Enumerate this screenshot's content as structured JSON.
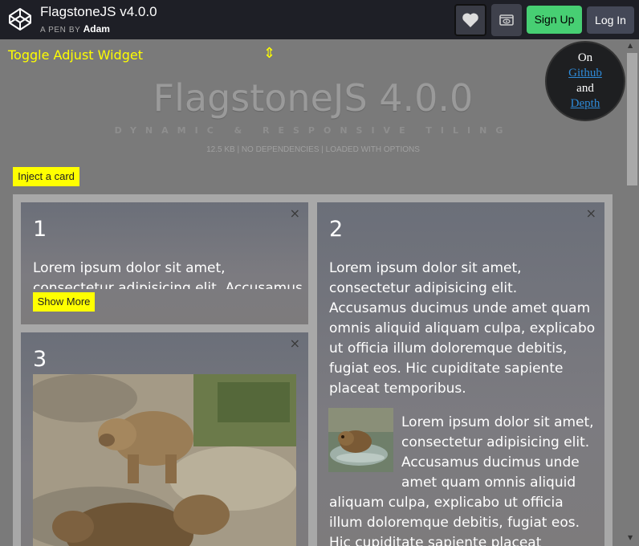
{
  "header": {
    "title": "FlagstoneJS v4.0.0",
    "by_label": "A PEN BY",
    "author": "Adam",
    "signup_label": "Sign Up",
    "login_label": "Log In"
  },
  "preview": {
    "toggle_label": "Toggle Adjust Widget",
    "toggle_icon": "⇕",
    "badge": {
      "line1": "On",
      "link1": "Github",
      "line2": "and",
      "link2": "Depth"
    },
    "title": "FlagstoneJS 4.0.0",
    "subtitle": "DYNAMIC & RESPONSIVE TILING",
    "meta": "12.5 KB | NO DEPENDENCIES | LOADED WITH OPTIONS",
    "inject_label": "Inject a card",
    "cards": [
      {
        "number": "1",
        "text": "Lorem ipsum dolor sit amet, consectetur adipisicing elit. Accusamus",
        "show_more": "Show More"
      },
      {
        "number": "2",
        "text": "Lorem ipsum dolor sit amet, consectetur adipisicing elit. Accusamus ducimus unde amet quam omnis aliquid aliquam culpa, explicabo ut officia illum doloremque debitis, fugiat eos. Hic cupiditate sapiente placeat temporibus.",
        "text2": "Lorem ipsum dolor sit amet, consectetur adipisicing elit. Accusamus ducimus unde amet quam omnis aliquid aliquam culpa, explicabo ut officia illum doloremque debitis, fugiat eos. Hic cupiditate sapiente placeat"
      },
      {
        "number": "3"
      }
    ],
    "close_icon": "×"
  },
  "colors": {
    "accent_yellow": "#ffff00",
    "signup_green": "#47cf73",
    "topbar": "#1e1f26"
  }
}
